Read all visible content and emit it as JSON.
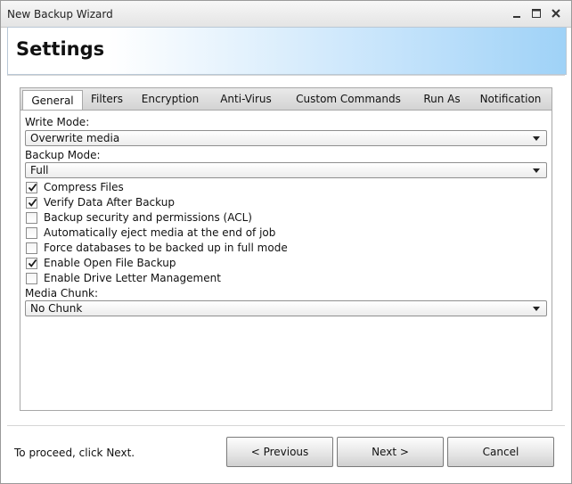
{
  "window": {
    "title": "New Backup Wizard",
    "controls": {
      "minimize": "minimize-icon",
      "maximize": "maximize-icon",
      "close": "close-icon"
    }
  },
  "header": {
    "title": "Settings"
  },
  "tabs": [
    {
      "label": "General",
      "active": true
    },
    {
      "label": "Filters",
      "active": false
    },
    {
      "label": "Encryption",
      "active": false
    },
    {
      "label": "Anti-Virus",
      "active": false
    },
    {
      "label": "Custom Commands",
      "active": false
    },
    {
      "label": "Run As",
      "active": false
    },
    {
      "label": "Notification",
      "active": false
    }
  ],
  "general": {
    "write_mode": {
      "label": "Write Mode:",
      "value": "Overwrite media"
    },
    "backup_mode": {
      "label": "Backup Mode:",
      "value": "Full"
    },
    "options": [
      {
        "label": "Compress Files",
        "checked": true
      },
      {
        "label": "Verify Data After Backup",
        "checked": true
      },
      {
        "label": "Backup security and permissions (ACL)",
        "checked": false
      },
      {
        "label": "Automatically eject media at the end of job",
        "checked": false
      },
      {
        "label": "Force databases to be backed up in full mode",
        "checked": false
      },
      {
        "label": "Enable Open File Backup",
        "checked": true
      },
      {
        "label": "Enable Drive Letter Management",
        "checked": false
      }
    ],
    "media_chunk": {
      "label": "Media Chunk:",
      "value": "No Chunk"
    }
  },
  "footer": {
    "hint": "To proceed, click Next.",
    "previous_label": "< Previous",
    "next_label": "Next >",
    "cancel_label": "Cancel"
  },
  "colors": {
    "header_gradient_end": "#9fd2f7",
    "check_mark": "#1a1a1a"
  }
}
